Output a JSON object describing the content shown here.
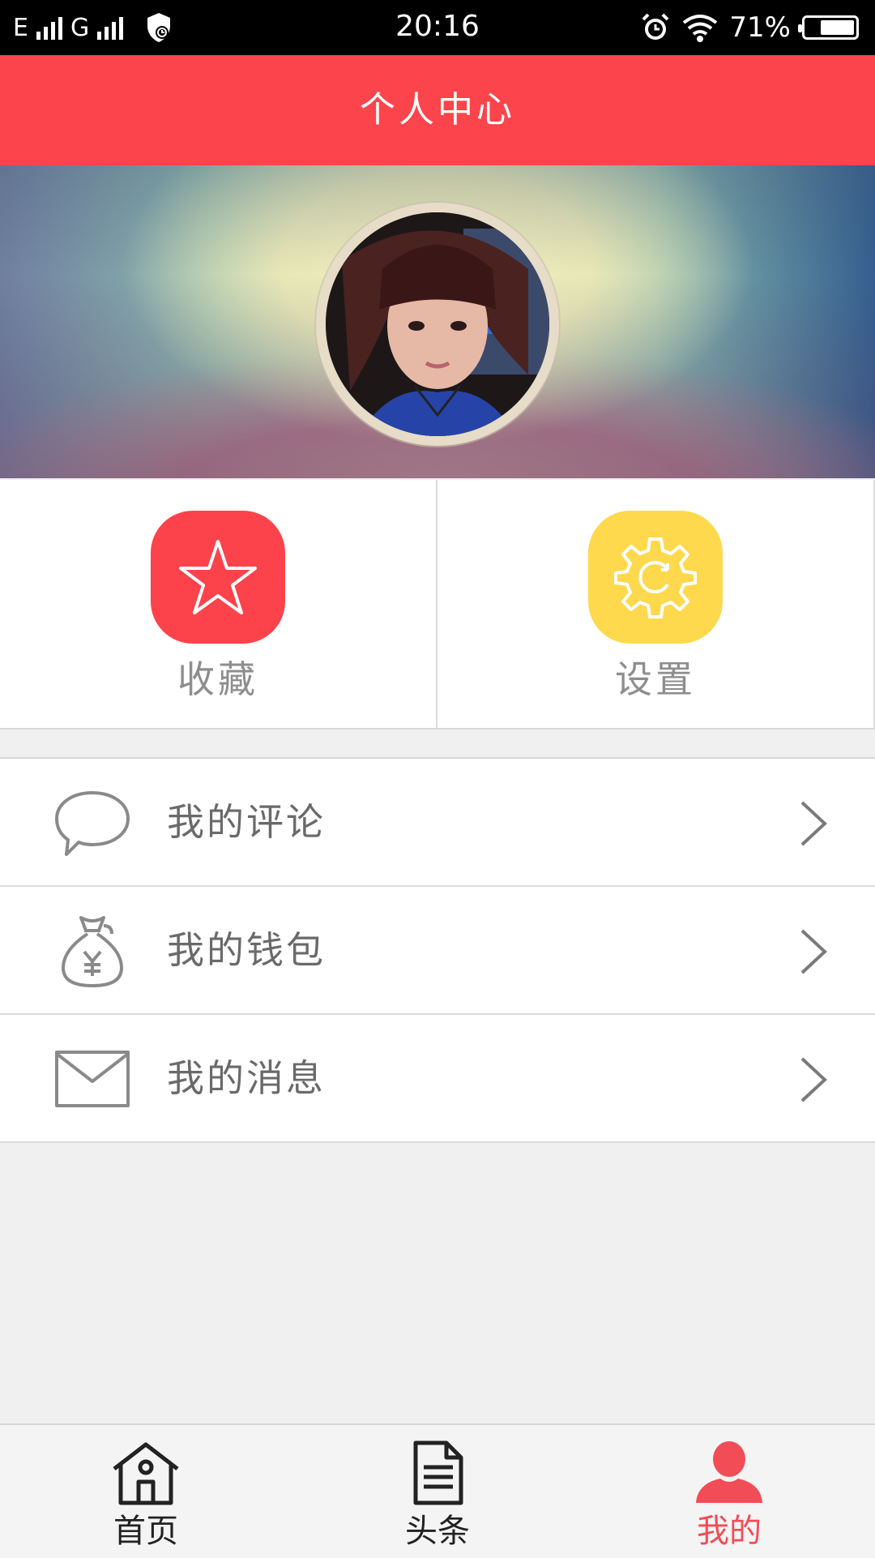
{
  "status_bar": {
    "network1": "E",
    "network2": "G",
    "time": "20:16",
    "battery_percent": "71%",
    "battery_level": 0.71
  },
  "header": {
    "title": "个人中心"
  },
  "profile": {
    "avatar_icon": "user-photo"
  },
  "quick_actions": [
    {
      "label": "收藏",
      "icon": "star-icon",
      "color": "#fc434c"
    },
    {
      "label": "设置",
      "icon": "gear-icon",
      "color": "#fed94d"
    }
  ],
  "menu": [
    {
      "label": "我的评论",
      "icon": "comment-icon"
    },
    {
      "label": "我的钱包",
      "icon": "money-bag-icon"
    },
    {
      "label": "我的消息",
      "icon": "envelope-icon"
    }
  ],
  "bottom_nav": [
    {
      "label": "首页",
      "icon": "home-icon",
      "active": false
    },
    {
      "label": "头条",
      "icon": "document-icon",
      "active": false
    },
    {
      "label": "我的",
      "icon": "user-icon",
      "active": true
    }
  ],
  "colors": {
    "accent": "#fc444c",
    "active_tab": "#f24c56",
    "settings": "#fed94d"
  }
}
